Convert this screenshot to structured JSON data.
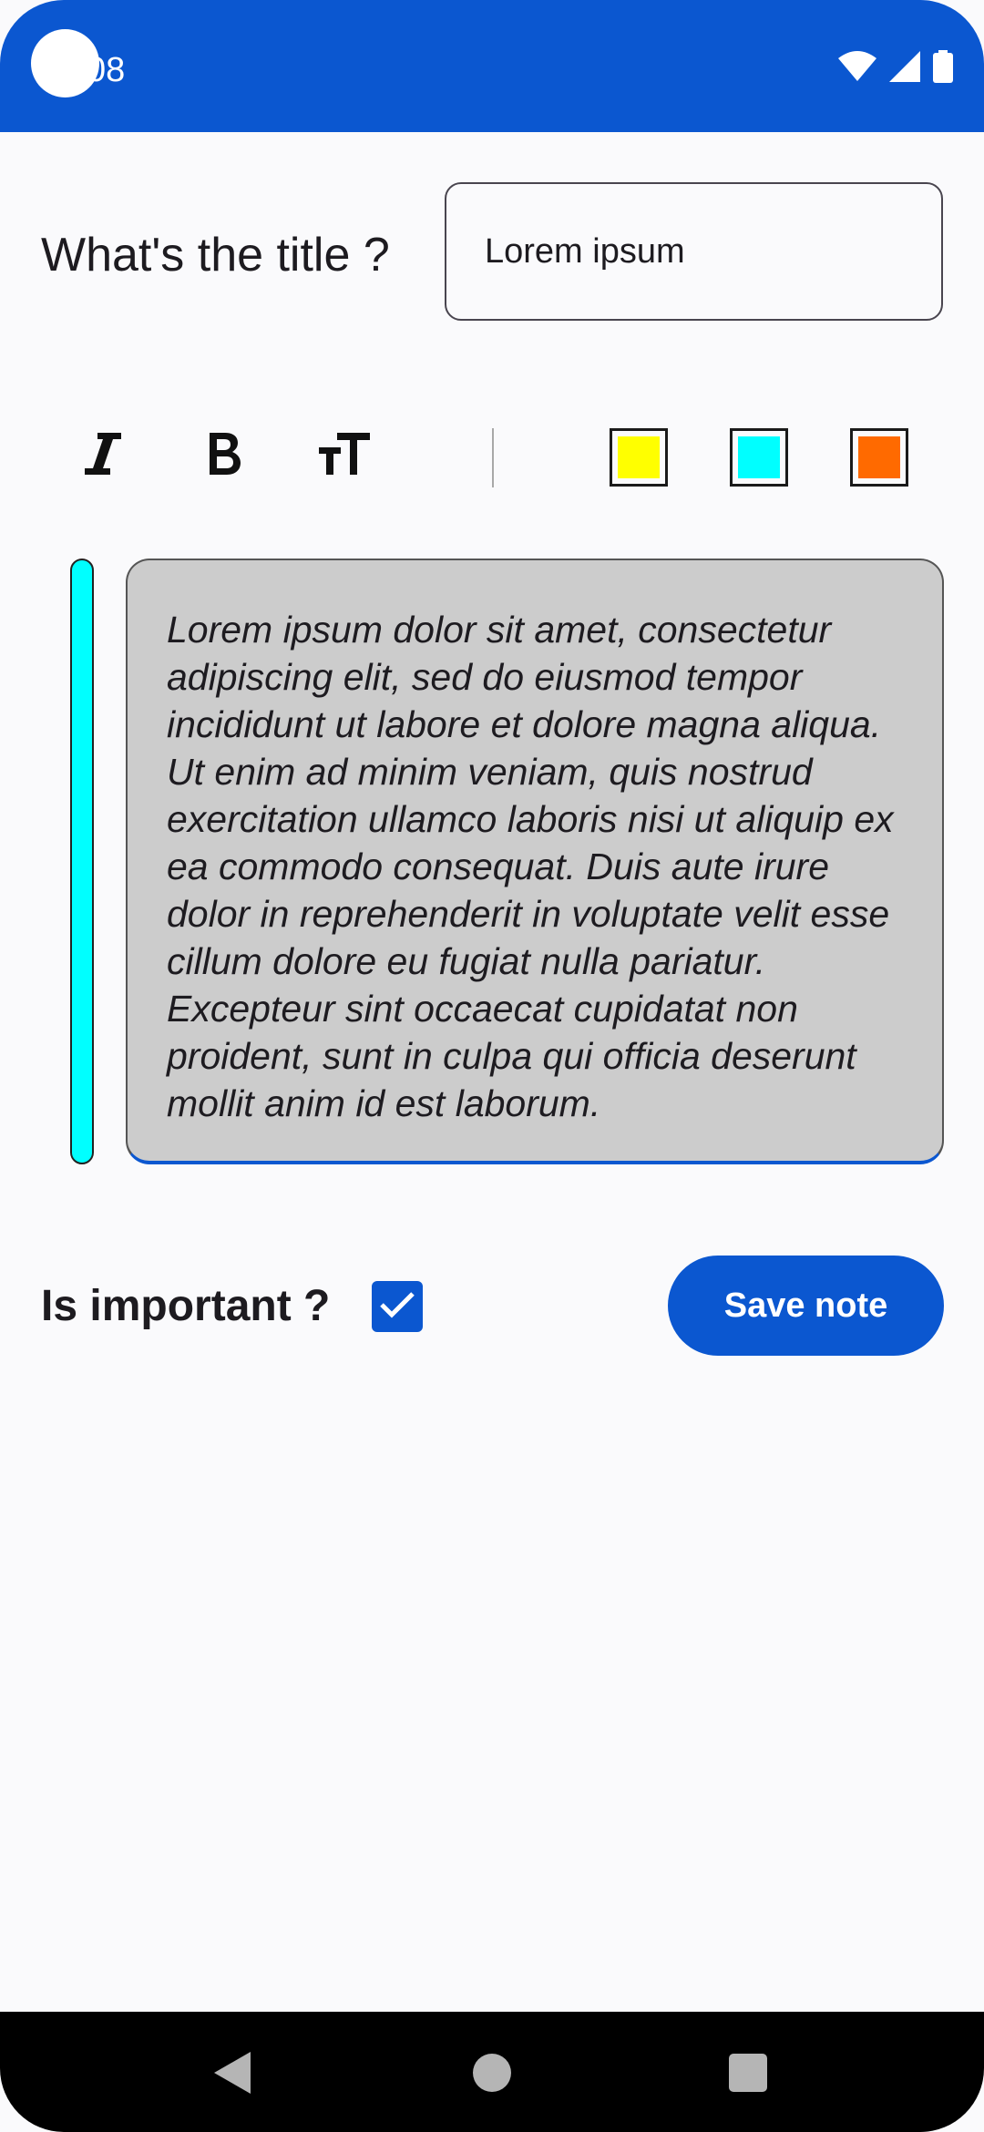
{
  "status_bar": {
    "time": "08",
    "color": "#0b57d0",
    "icons": [
      "wifi-icon",
      "signal-icon",
      "battery-icon"
    ]
  },
  "form": {
    "title_label": "What's the title ?",
    "title_value": "Lorem ipsum",
    "note_text": "Lorem ipsum dolor sit amet, consectetur adipiscing elit, sed do eiusmod tempor incididunt ut labore et dolore magna aliqua. Ut enim ad minim veniam, quis nostrud exercitation ullamco laboris nisi ut aliquip ex ea commodo consequat. Duis aute irure dolor in reprehenderit in voluptate velit esse cillum dolore eu fugiat nulla pariatur. Excepteur sint occaecat cupidatat non proident, sunt in culpa qui officia deserunt mollit anim id est laborum.",
    "important_label": "Is important ?",
    "important_checked": true,
    "save_label": "Save note"
  },
  "toolbar": {
    "tools": [
      "italic-icon",
      "bold-icon",
      "text-size-icon"
    ],
    "colors": [
      "#ffff00",
      "#00ffff",
      "#ff6a00"
    ],
    "selected_color": "#00ffff"
  },
  "nav_bar": {
    "buttons": [
      "back-icon",
      "home-icon",
      "recents-icon"
    ]
  }
}
